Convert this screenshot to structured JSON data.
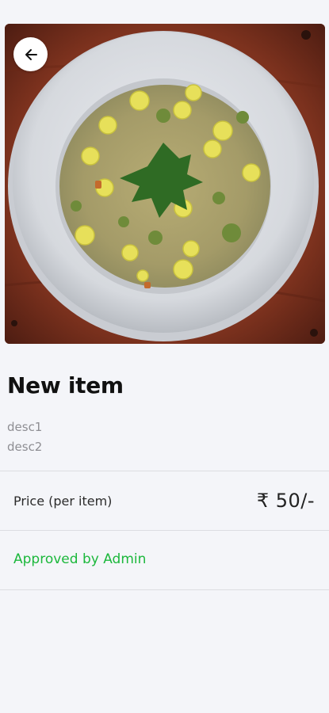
{
  "item": {
    "title": "New item",
    "descriptions": [
      "desc1",
      "desc2"
    ]
  },
  "pricing": {
    "label": "Price (per item)",
    "value": "₹ 50/-"
  },
  "status": {
    "text": "Approved by Admin",
    "color": "#1cb83c"
  },
  "icons": {
    "back": "arrow-left-icon"
  },
  "colors": {
    "background": "#f4f5f9",
    "divider": "#dcdde2"
  }
}
